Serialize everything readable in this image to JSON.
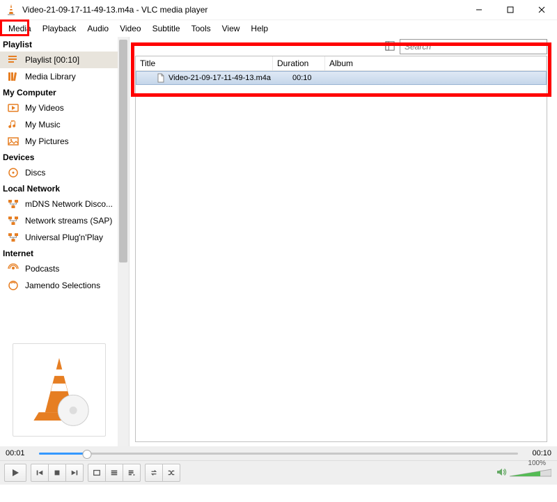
{
  "window": {
    "title": "Video-21-09-17-11-49-13.m4a - VLC media player"
  },
  "menu": {
    "media": "Media",
    "playback": "Playback",
    "audio": "Audio",
    "video": "Video",
    "subtitle": "Subtitle",
    "tools": "Tools",
    "view": "View",
    "help": "Help"
  },
  "sidebar": {
    "sections": {
      "playlist": "Playlist",
      "mycomputer": "My Computer",
      "devices": "Devices",
      "localnetwork": "Local Network",
      "internet": "Internet"
    },
    "playlist_item": "Playlist [00:10]",
    "media_library": "Media Library",
    "my_videos": "My Videos",
    "my_music": "My Music",
    "my_pictures": "My Pictures",
    "discs": "Discs",
    "mdns": "mDNS Network Disco...",
    "sap": "Network streams (SAP)",
    "upnp": "Universal Plug'n'Play",
    "podcasts": "Podcasts",
    "jamendo": "Jamendo Selections"
  },
  "search": {
    "placeholder": "Search"
  },
  "playlist": {
    "columns": {
      "title": "Title",
      "duration": "Duration",
      "album": "Album"
    },
    "rows": [
      {
        "title": "Video-21-09-17-11-49-13.m4a",
        "duration": "00:10",
        "album": ""
      }
    ]
  },
  "time": {
    "elapsed": "00:01",
    "total": "00:10"
  },
  "volume": {
    "label": "100%"
  }
}
